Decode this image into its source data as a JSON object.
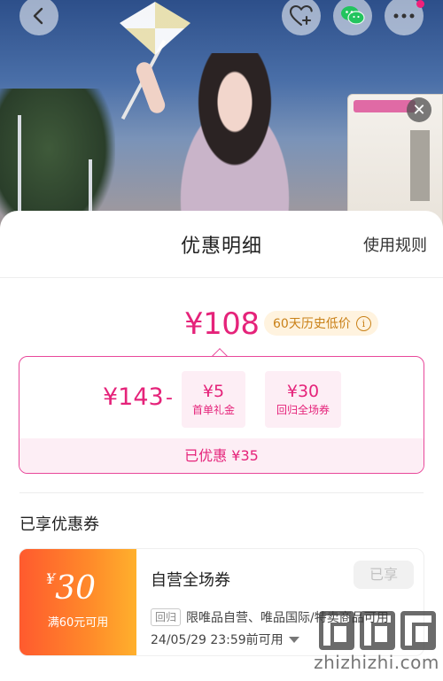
{
  "header": {
    "sheet_title": "优惠明细",
    "rules_label": "使用规则"
  },
  "price": {
    "final": "¥108",
    "low_badge": "60天历史低价",
    "original": "¥143",
    "minus": "-",
    "discounts": [
      {
        "amount": "¥5",
        "label": "首单礼金"
      },
      {
        "amount": "¥30",
        "label": "回归全场券"
      }
    ],
    "saved": "已优惠 ¥35"
  },
  "coupons": {
    "section_title": "已享优惠券",
    "items": [
      {
        "currency": "¥",
        "amount": "30",
        "condition": "满60元可用",
        "name": "自营全场券",
        "status": "已享",
        "tag": "回归",
        "scope": "限唯品自营、唯品国际/特卖商品可用",
        "expiry": "24/05/29 23:59前可用"
      }
    ]
  },
  "icons": {
    "back": "chevron-left-icon",
    "favorite": "heart-plus-icon",
    "wechat": "wechat-icon",
    "more": "more-dots-icon",
    "close": "close-icon",
    "info": "info-icon"
  },
  "colors": {
    "accent": "#e5237a",
    "accent_bg": "#fdeef5",
    "badge_text": "#c98118",
    "badge_bg": "#fff3df",
    "coupon_gradient_start": "#ff5a2e",
    "coupon_gradient_end": "#ffb02c"
  },
  "watermark": {
    "text": "zhizhizhi.com"
  }
}
